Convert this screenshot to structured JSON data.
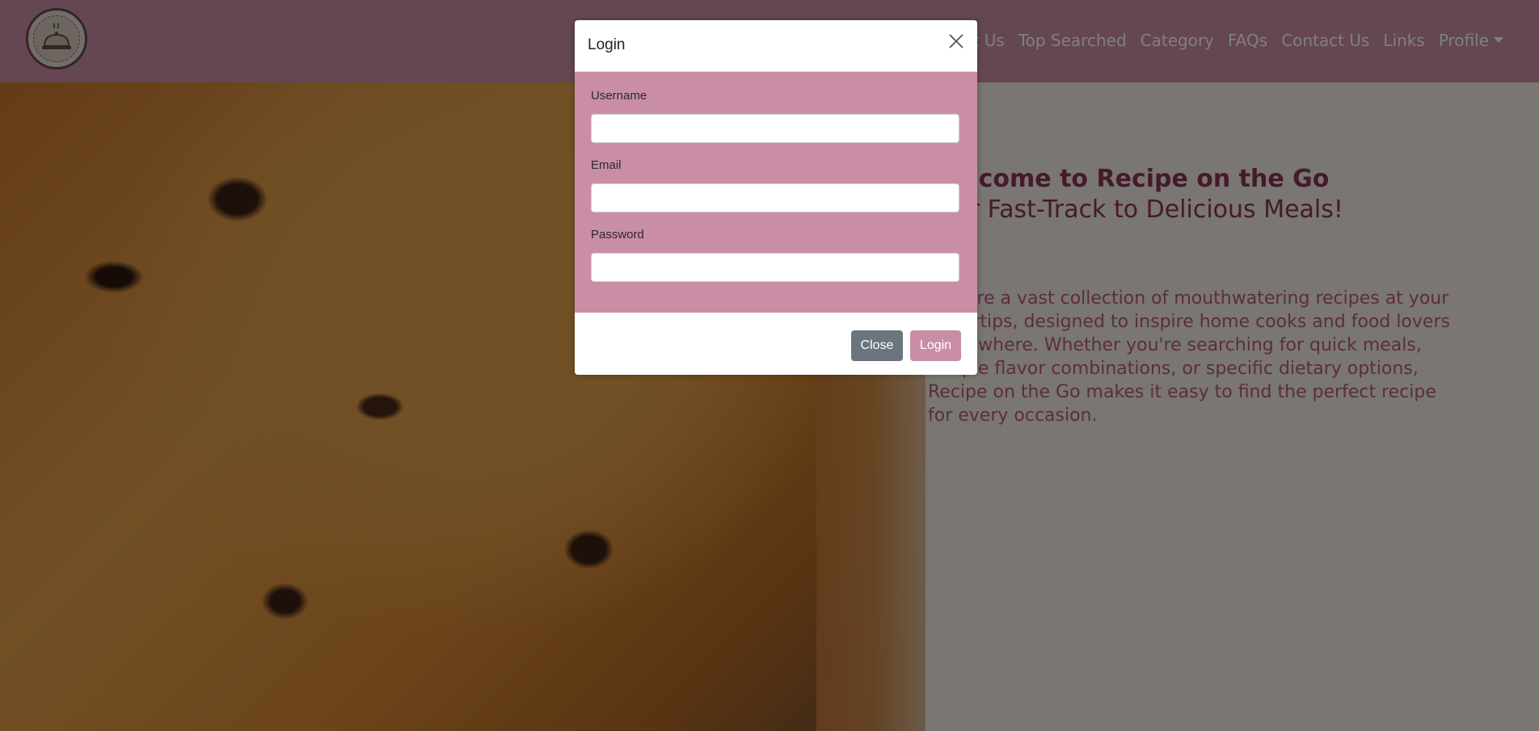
{
  "nav": {
    "links": [
      "About Us",
      "Top Searched",
      "Category",
      "FAQs",
      "Contact Us",
      "Links",
      "Profile"
    ]
  },
  "hero": {
    "title_line1": "Welcome to Recipe on the Go",
    "title_line2": "Your Fast-Track to Delicious Meals!",
    "description": "Explore a vast collection of mouthwatering recipes at your fingertips, designed to inspire home cooks and food lovers everywhere. Whether you're searching for quick meals, unique flavor combinations, or specific dietary options, Recipe on the Go makes it easy to find the perfect recipe for every occasion."
  },
  "modal": {
    "title": "Login",
    "fields": {
      "username_label": "Username",
      "username_value": "",
      "email_label": "Email",
      "email_value": "",
      "password_label": "Password",
      "password_value": ""
    },
    "close_label": "Close",
    "login_label": "Login"
  },
  "colors": {
    "brand_pink": "#c98ea5",
    "brand_dark": "#8a3559",
    "close_button": "#6c757d"
  },
  "icons": {
    "logo": "cloche-logo-icon",
    "close": "close-icon",
    "profile_dropdown": "chevron-down-icon"
  }
}
